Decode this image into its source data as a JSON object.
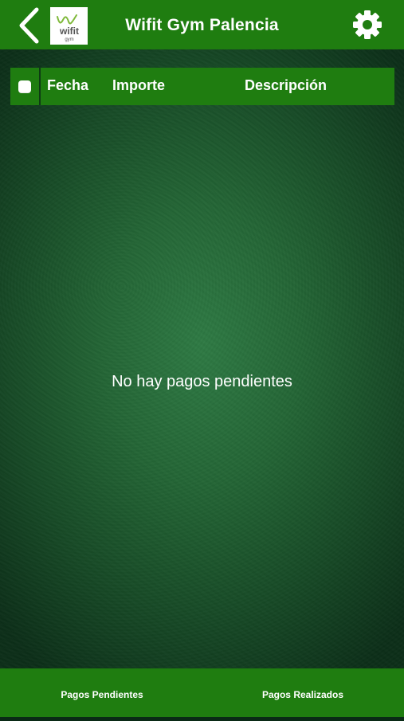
{
  "header": {
    "title": "Wifit Gym Palencia",
    "back_icon": "chevron-left-icon",
    "settings_icon": "gear-icon",
    "logo_text": "wifit",
    "logo_subtext": "gym"
  },
  "table": {
    "columns": [
      "Fecha",
      "Importe",
      "Descripción"
    ],
    "rows": []
  },
  "empty_message": "No hay pagos pendientes",
  "tabs": [
    {
      "label": "Pagos Pendientes"
    },
    {
      "label": "Pagos Realizados"
    }
  ],
  "colors": {
    "primary_green": "#1f7d10",
    "background_green": "#246636"
  }
}
